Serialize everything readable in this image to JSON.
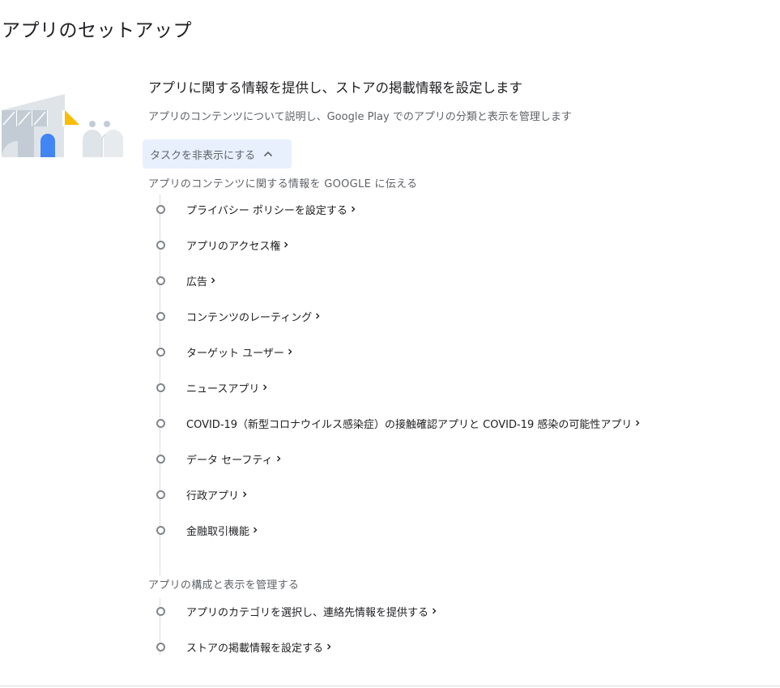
{
  "page": {
    "title": "アプリのセットアップ"
  },
  "section": {
    "heading": "アプリに関する情報を提供し、ストアの掲載情報を設定します",
    "description": "アプリのコンテンツについて説明し、Google Play でのアプリの分類と表示を管理します",
    "toggle_label": "タスクを非表示にする",
    "toggle_icon": "chevron-up-icon"
  },
  "groups": [
    {
      "title": "アプリのコンテンツに関する情報を GOOGLE に伝える",
      "tasks": [
        {
          "label": "プライバシー ポリシーを設定する"
        },
        {
          "label": "アプリのアクセス権"
        },
        {
          "label": "広告"
        },
        {
          "label": "コンテンツのレーティング"
        },
        {
          "label": "ターゲット ユーザー"
        },
        {
          "label": "ニュースアプリ"
        },
        {
          "label": "COVID-19（新型コロナウイルス感染症）の接触確認アプリと COVID-19 感染の可能性アプリ"
        },
        {
          "label": "データ セーフティ"
        },
        {
          "label": "行政アプリ"
        },
        {
          "label": "金融取引機能"
        }
      ]
    },
    {
      "title": "アプリの構成と表示を管理する",
      "tasks": [
        {
          "label": "アプリのカテゴリを選択し、連絡先情報を提供する"
        },
        {
          "label": "ストアの掲載情報を設定する"
        }
      ]
    }
  ],
  "colors": {
    "accent_blue": "#4285f4",
    "accent_yellow": "#fbbc04",
    "toggle_bg": "#e8f0fe",
    "illustration_gray": "#c3ccd4",
    "text_secondary": "#5f6368"
  }
}
